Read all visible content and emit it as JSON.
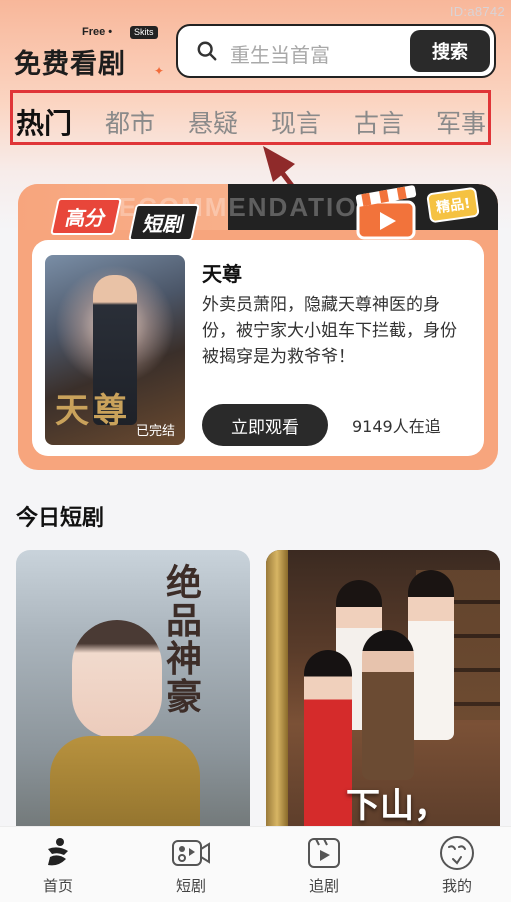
{
  "watermark": "ID:a8742",
  "header": {
    "logo_free": "Free •",
    "logo_skits": "Skits",
    "logo_name": "免费看剧",
    "search_placeholder": "重生当首富",
    "search_button": "搜索"
  },
  "tabs": [
    {
      "label": "热门",
      "active": true
    },
    {
      "label": "都市",
      "active": false
    },
    {
      "label": "悬疑",
      "active": false
    },
    {
      "label": "现言",
      "active": false
    },
    {
      "label": "古言",
      "active": false
    },
    {
      "label": "军事",
      "active": false
    }
  ],
  "featured": {
    "bg_text": "RECOMMENDATION",
    "badge_left": "高分",
    "badge_right": "短剧",
    "badge_premium": "精品!",
    "poster_title": "天尊",
    "poster_status": "已完结",
    "title": "天尊",
    "description": "外卖员萧阳，隐藏天尊神医的身份，被宁家大小姐车下拦截，身份被揭穿是为救爷爷！",
    "watch_button": "立即观看",
    "followers": "9149人在追"
  },
  "today": {
    "title": "今日短剧",
    "posters": [
      {
        "title": "绝品神豪"
      },
      {
        "title": "下山，"
      }
    ]
  },
  "bottom_nav": [
    {
      "label": "首页",
      "icon": "home-icon"
    },
    {
      "label": "短剧",
      "icon": "video-camera-icon"
    },
    {
      "label": "追剧",
      "icon": "play-clapper-icon"
    },
    {
      "label": "我的",
      "icon": "profile-icon"
    }
  ],
  "colors": {
    "accent_dark": "#2a2a2a",
    "featured_bg": "#f7a57d",
    "highlight_outline": "#e03538"
  }
}
